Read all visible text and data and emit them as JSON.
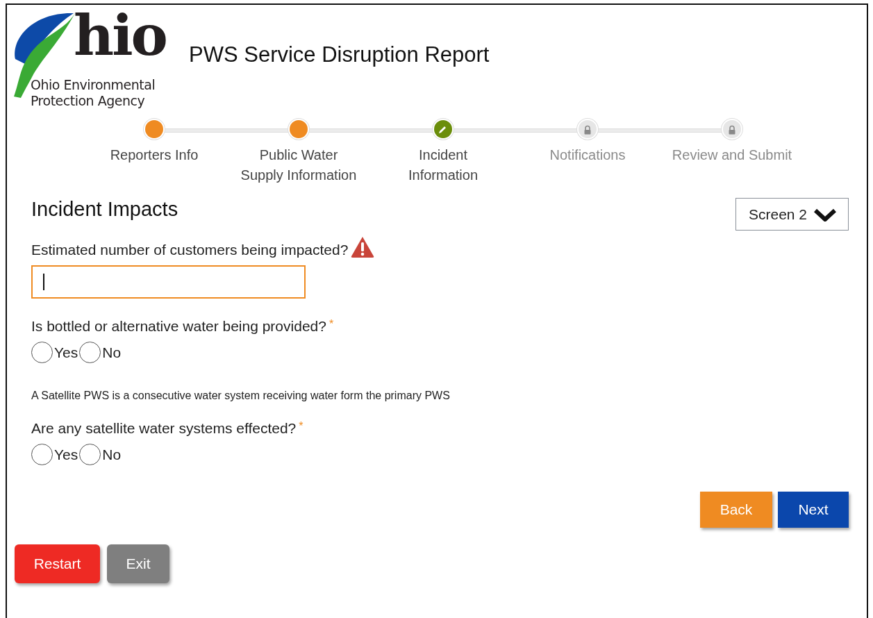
{
  "logo": {
    "wordmark": "hio",
    "agency_line_1": "Ohio Environmental",
    "agency_line_2": "Protection Agency"
  },
  "title": "PWS Service Disruption Report",
  "steps": [
    {
      "label": "Reporters Info",
      "kind": "complete"
    },
    {
      "label": "Public Water Supply Information",
      "kind": "complete"
    },
    {
      "label": "Incident Information",
      "kind": "current"
    },
    {
      "label": "Notifications",
      "kind": "locked"
    },
    {
      "label": "Review and Submit",
      "kind": "locked"
    }
  ],
  "section_title": "Incident Impacts",
  "screen_select": {
    "value": "Screen 2"
  },
  "questions": [
    {
      "kind": "text",
      "label": "Estimated number of customers being impacted?",
      "warning": true,
      "focused": true
    },
    {
      "kind": "radio",
      "label": "Is bottled or alternative water being provided?",
      "required": true,
      "options": [
        {
          "label": "Yes",
          "selected": false
        },
        {
          "label": "No",
          "selected": false
        }
      ]
    },
    {
      "kind": "note",
      "label": "A Satellite PWS is a consecutive water system receiving water form the primary PWS"
    },
    {
      "kind": "radio",
      "label": "Are any satellite water systems effected?",
      "required": true,
      "options": [
        {
          "label": "Yes",
          "selected": false
        },
        {
          "label": "No",
          "selected": false
        }
      ]
    }
  ],
  "nav_buttons": [
    {
      "label": "Back",
      "kind": "back"
    },
    {
      "label": "Next",
      "kind": "next"
    }
  ],
  "bottom_buttons": [
    {
      "label": "Restart",
      "kind": "restart"
    },
    {
      "label": "Exit",
      "kind": "exit"
    }
  ],
  "required_mark": "*"
}
